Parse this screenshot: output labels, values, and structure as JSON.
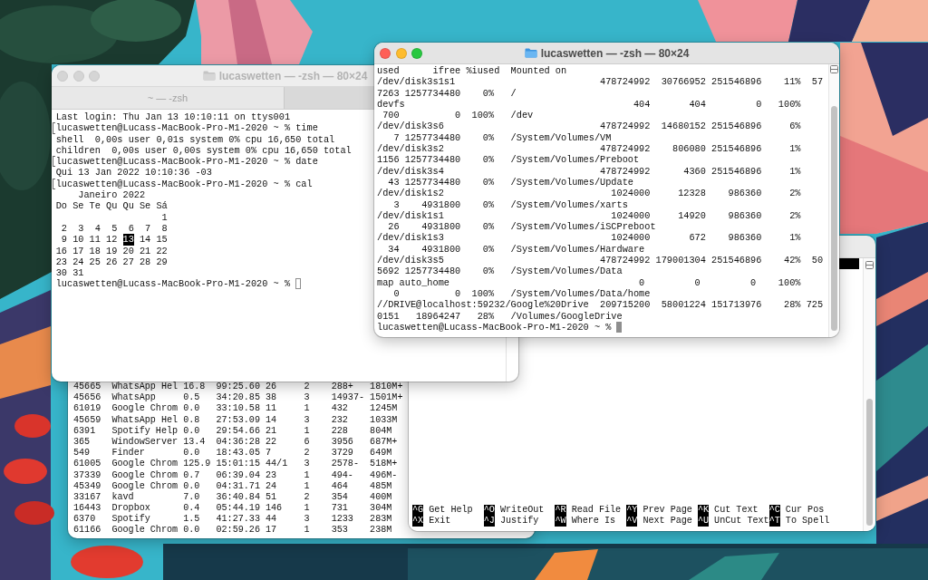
{
  "desktop": {
    "windows": [
      {
        "kind": "terminal",
        "lines": [
          "45665  WhatsApp Hel 16.8  99:25.60 26     2    288+   1810M+",
          "45656  WhatsApp     0.5   34:20.85 38     3    14937- 1501M+",
          "61019  Google Chrom 0.0   33:10.58 11     1    432    1245M",
          "45659  WhatsApp Hel 0.8   27:53.09 14     3    232    1033M",
          "6391   Spotify Help 0.0   29:54.66 21     1    228    804M",
          "365    WindowServer 13.4  04:36:28 22     6    3956   687M+",
          "549    Finder       0.0   18:43.05 7      2    3729   649M",
          "61005  Google Chrom 125.9 15:01:15 44/1   3    2578-  518M+",
          "37339  Google Chrom 0.7   06:39.04 23     1    494-   496M-",
          "45349  Google Chrom 0.0   04:31.71 24     1    464    485M",
          "33167  kavd         7.0   36:40.84 51     2    354    400M",
          "16443  Dropbox      0.4   05:44.19 146    1    731    304M",
          "6370   Spotify      1.5   41:27.33 44     3    1233   283M",
          "61166  Google Chrom 0.0   02:59.26 17     1    353    238M"
        ]
      },
      {
        "kind": "nano",
        "shortcut_rows": [
          [
            {
              "key": "^G",
              "label": "Get Help"
            },
            {
              "key": "^O",
              "label": "WriteOut"
            },
            {
              "key": "^R",
              "label": "Read File"
            },
            {
              "key": "^Y",
              "label": "Prev Page"
            },
            {
              "key": "^K",
              "label": "Cut Text"
            },
            {
              "key": "^C",
              "label": "Cur Pos"
            }
          ],
          [
            {
              "key": "^X",
              "label": "Exit"
            },
            {
              "key": "^J",
              "label": "Justify"
            },
            {
              "key": "^W",
              "label": "Where Is"
            },
            {
              "key": "^V",
              "label": "Next Page"
            },
            {
              "key": "^U",
              "label": "UnCut Text"
            },
            {
              "key": "^T",
              "label": "To Spell"
            }
          ]
        ]
      },
      {
        "kind": "terminal",
        "title": "lucaswetten — -zsh — 80×24",
        "active": false,
        "tabs": [
          {
            "label": "~ — -zsh",
            "selected": true
          },
          {
            "selected": false
          }
        ],
        "cursor": true,
        "lines": [
          {
            "text": "Last login: Thu Jan 13 10:10:11 on ttys001",
            "marked": false
          },
          {
            "text": "lucaswetten@Lucass-MacBook-Pro-M1-2020 ~ % time",
            "marked": true
          },
          {
            "text": "shell  0,00s user 0,01s system 0% cpu 16,650 total",
            "marked": false
          },
          {
            "text": "children  0,00s user 0,00s system 0% cpu 16,650 total",
            "marked": false
          },
          {
            "text": "lucaswetten@Lucass-MacBook-Pro-M1-2020 ~ % date",
            "marked": true
          },
          {
            "text": "Qui 13 Jan 2022 10:10:36 -03",
            "marked": false
          },
          {
            "text": "lucaswetten@Lucass-MacBook-Pro-M1-2020 ~ % cal",
            "marked": true
          },
          {
            "text": "    Janeiro 2022",
            "marked": false
          },
          {
            "text": "Do Se Te Qu Qu Se Sá",
            "marked": false
          },
          {
            "text": "                   1",
            "marked": false
          },
          {
            "text": " 2  3  4  5  6  7  8",
            "marked": false
          },
          {
            "segments": [
              {
                "text": " 9 10 11 12 ",
                "highlighted": false
              },
              {
                "text": "13",
                "highlighted": true
              },
              {
                "text": " 14 15",
                "highlighted": false
              }
            ],
            "marked": false
          },
          {
            "text": "16 17 18 19 20 21 22",
            "marked": false
          },
          {
            "text": "23 24 25 26 27 28 29",
            "marked": false
          },
          {
            "text": "30 31",
            "marked": false
          },
          {
            "text": "lucaswetten@Lucass-MacBook-Pro-M1-2020 ~ %",
            "marked": false
          }
        ]
      },
      {
        "kind": "terminal",
        "title": "lucaswetten — -zsh — 80×24",
        "active": true,
        "cursor": true,
        "lines": [
          "used      ifree %iused  Mounted on",
          "/dev/disk3s1s1                          478724992  30766952 251546896    11%  57",
          "7263 1257734480    0%   /",
          "devfs                                         404       404         0   100%",
          " 700          0  100%   /dev",
          "/dev/disk3s6                            478724992  14680152 251546896     6%",
          "   7 1257734480    0%   /System/Volumes/VM",
          "/dev/disk3s2                            478724992    806080 251546896     1%",
          "1156 1257734480    0%   /System/Volumes/Preboot",
          "/dev/disk3s4                            478724992      4360 251546896     1%",
          "  43 1257734480    0%   /System/Volumes/Update",
          "/dev/disk1s2                              1024000     12328    986360     2%",
          "   3    4931800    0%   /System/Volumes/xarts",
          "/dev/disk1s1                              1024000     14920    986360     2%",
          "  26    4931800    0%   /System/Volumes/iSCPreboot",
          "/dev/disk1s3                              1024000       672    986360     1%",
          "  34    4931800    0%   /System/Volumes/Hardware",
          "/dev/disk3s5                            478724992 179001304 251546896    42%  50",
          "5692 1257734480    0%   /System/Volumes/Data",
          "map auto_home                                  0         0         0    100%",
          "   0          0  100%   /System/Volumes/Data/home",
          "//DRIVE@localhost:59232/Google%20Drive  209715200  58001224 151713976    28% 725",
          "0151   18964247   28%   /Volumes/GoogleDrive",
          "lucaswetten@Lucass-MacBook-Pro-M1-2020 ~ %"
        ]
      }
    ]
  }
}
